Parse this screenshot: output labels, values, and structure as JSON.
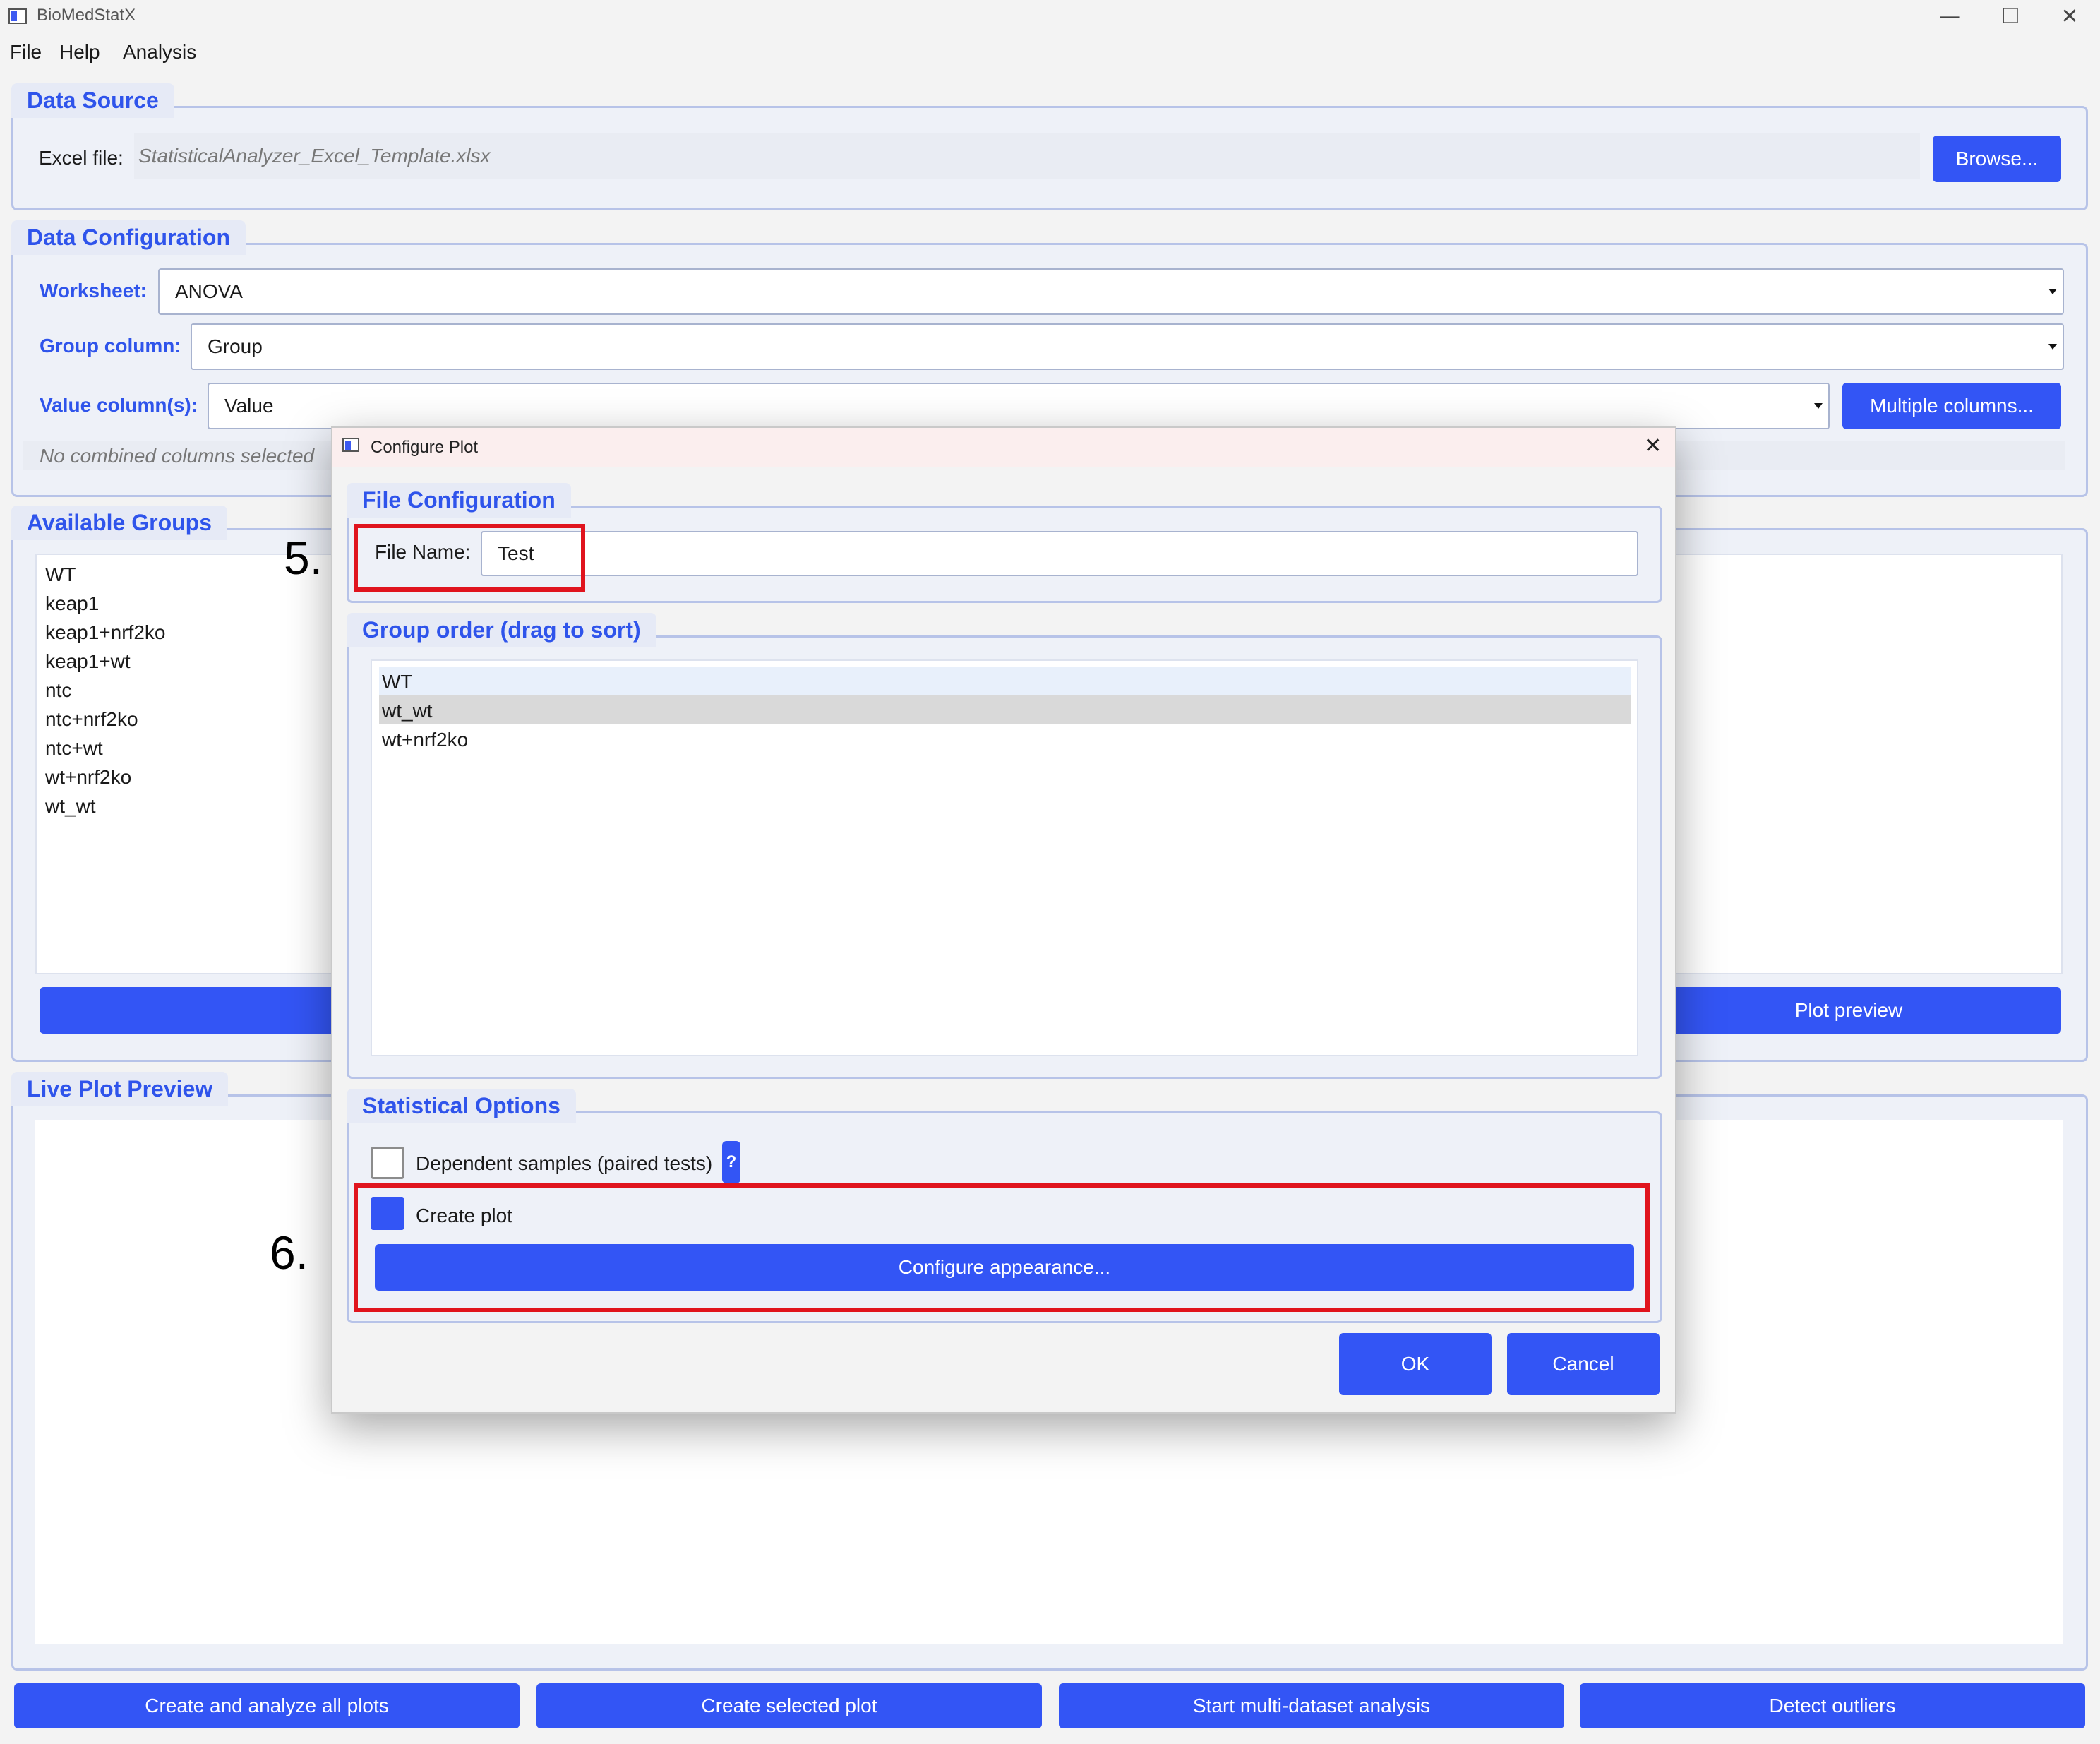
{
  "window": {
    "title": "BioMedStatX",
    "controls": {
      "minimize": "—",
      "maximize": "☐",
      "close": "✕"
    }
  },
  "menu": [
    "File",
    "Help",
    "Analysis"
  ],
  "data_source": {
    "title": "Data Source",
    "excel_label": "Excel file:",
    "excel_value": "StatisticalAnalyzer_Excel_Template.xlsx",
    "browse_label": "Browse..."
  },
  "data_config": {
    "title": "Data Configuration",
    "worksheet_label": "Worksheet:",
    "worksheet_value": "ANOVA",
    "group_column_label": "Group column:",
    "group_column_value": "Group",
    "value_columns_label": "Value column(s):",
    "value_columns_value": "Value",
    "multiple_columns_label": "Multiple columns...",
    "combined_note": "No combined columns selected"
  },
  "available_groups": {
    "title": "Available Groups",
    "items": [
      "WT",
      "keap1",
      "keap1+nrf2ko",
      "keap1+wt",
      "ntc",
      "ntc+nrf2ko",
      "ntc+wt",
      "wt+nrf2ko",
      "wt_wt"
    ],
    "plot_preview_label": "Plot preview"
  },
  "live_plot": {
    "title": "Live Plot Preview"
  },
  "bottom_buttons": [
    "Create and analyze all plots",
    "Create selected plot",
    "Start multi-dataset analysis",
    "Detect outliers"
  ],
  "dialog": {
    "title": "Configure Plot",
    "close": "✕",
    "file_config_title": "File Configuration",
    "file_name_label": "File Name:",
    "file_name_value": "Test",
    "group_order_title": "Group order (drag to sort)",
    "group_order_items": [
      "WT",
      "wt_wt",
      "wt+nrf2ko"
    ],
    "stat_options_title": "Statistical Options",
    "dependent_label": "Dependent samples (paired tests)",
    "help_label": "?",
    "create_plot_label": "Create plot",
    "configure_appearance_label": "Configure appearance...",
    "ok_label": "OK",
    "cancel_label": "Cancel"
  },
  "annotations": {
    "step5": "5.",
    "step6": "6."
  },
  "colors": {
    "accent": "#3355f5",
    "title_blue": "#2f54eb",
    "highlight_red": "#e0141e"
  }
}
